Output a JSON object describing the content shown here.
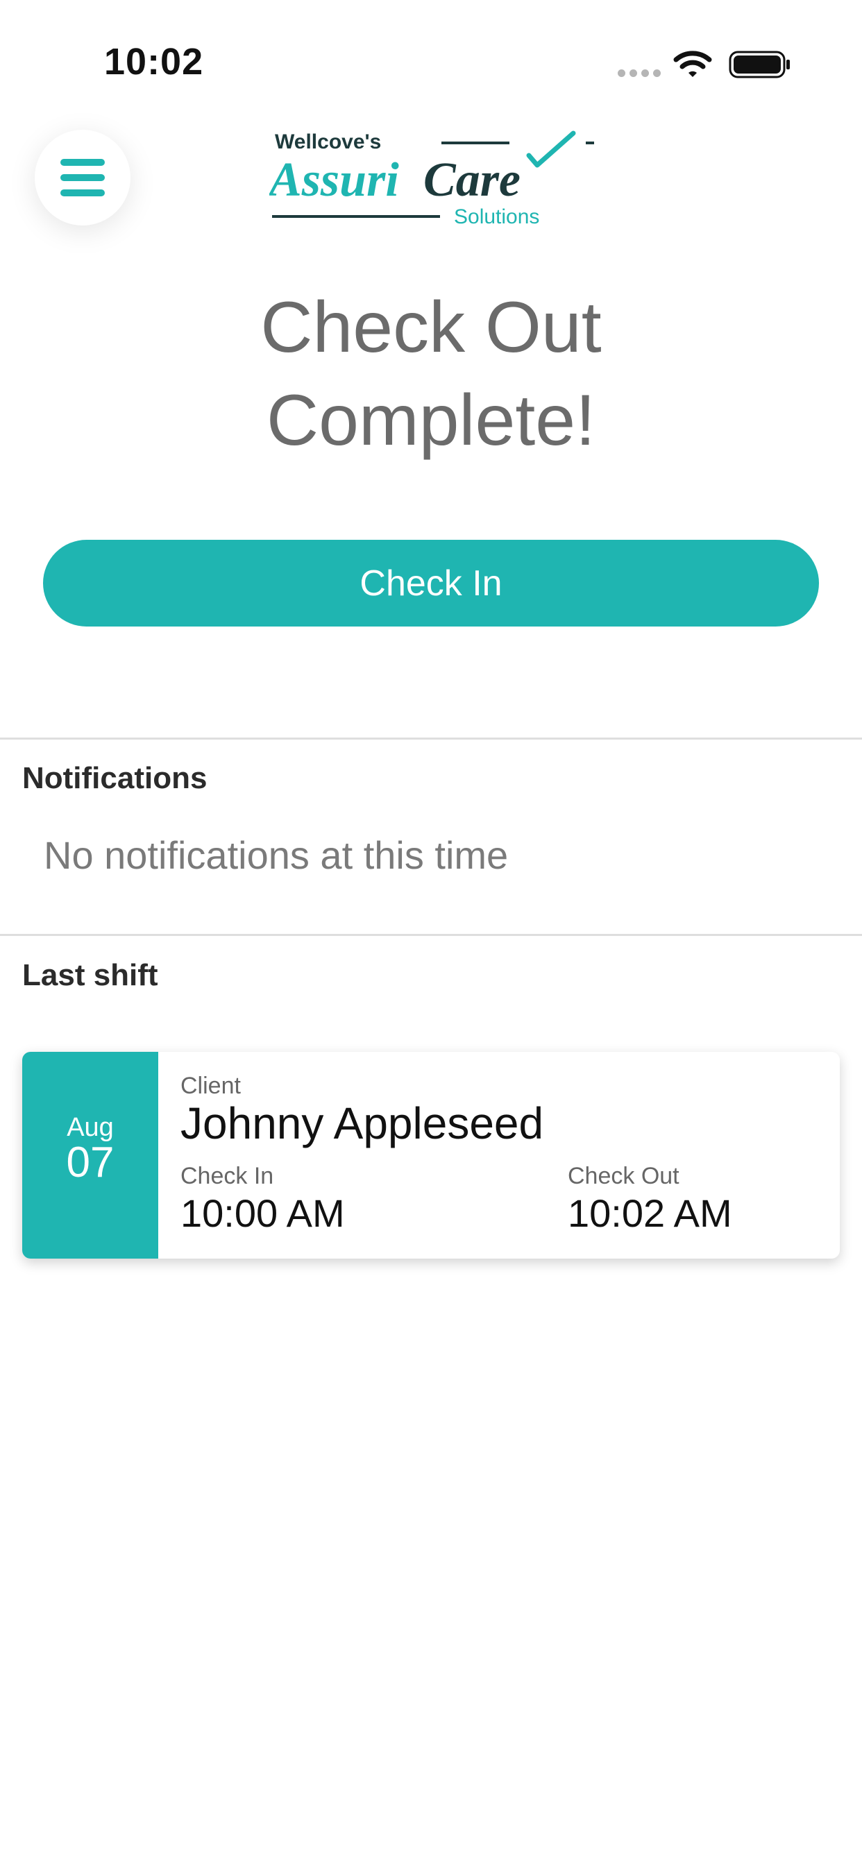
{
  "status_bar": {
    "time": "10:02",
    "icons": [
      "cellular-signal-icon",
      "wifi-icon",
      "battery-icon"
    ]
  },
  "header": {
    "menu_icon": "hamburger-icon",
    "logo": {
      "top": "Wellcove's",
      "main_part1": "Assuri",
      "main_part2": "Care",
      "bottom": "Solutions"
    }
  },
  "main": {
    "title_line1": "Check Out",
    "title_line2": "Complete!",
    "checkin_button_label": "Check In"
  },
  "notifications": {
    "heading": "Notifications",
    "empty_message": "No notifications at this time"
  },
  "last_shift": {
    "heading": "Last shift",
    "month": "Aug",
    "day": "07",
    "client_label": "Client",
    "client_name": "Johnny Appleseed",
    "checkin_label": "Check In",
    "checkin_time": "10:00 AM",
    "checkout_label": "Check Out",
    "checkout_time": "10:02 AM"
  },
  "colors": {
    "accent": "#1fb5b1",
    "logo_dark": "#1d3a3c",
    "title_text": "#6b6b6b"
  }
}
